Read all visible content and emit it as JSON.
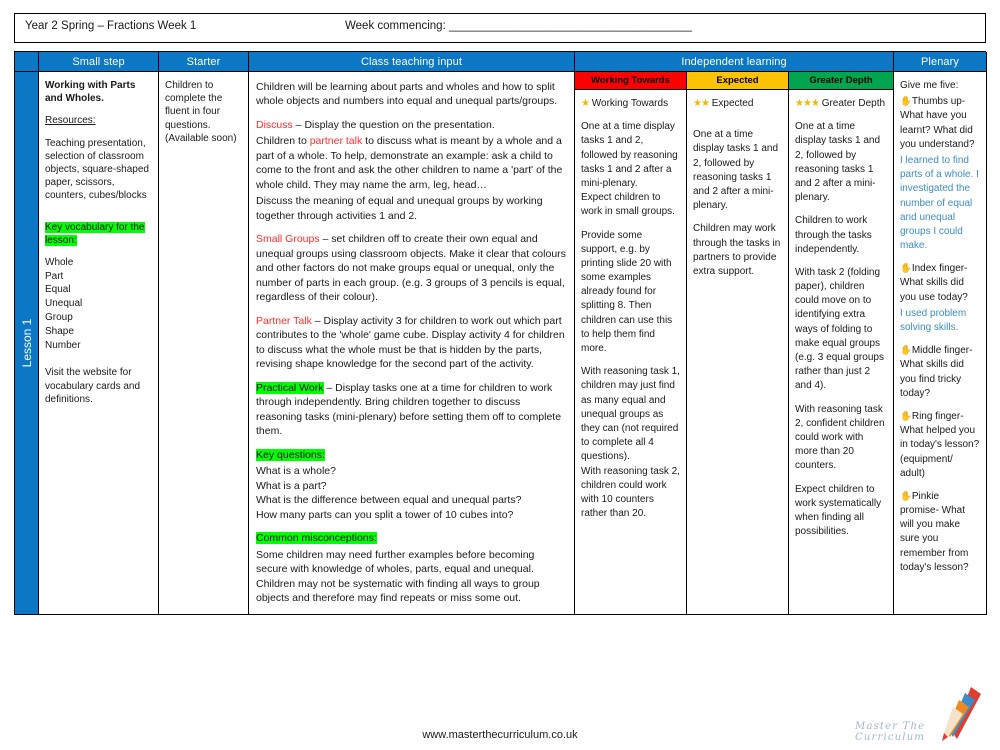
{
  "document": {
    "title_left": "Year 2 Spring – Fractions Week 1",
    "title_right": "Week commencing: ______________________________________",
    "footer_url": "www.masterthecurriculum.co.uk",
    "logo_wordmark": "Master The Curriculum"
  },
  "colors": {
    "header_blue": "#0C77C4",
    "working_towards_red": "#FE0000",
    "expected_amber": "#FDC201",
    "greater_depth_green": "#00A550",
    "highlight_green": "#00FF00",
    "accent_red_text": "#FF2E2E",
    "blue_text": "#3C8DC5"
  },
  "table": {
    "headers": {
      "lesson_spine": "",
      "small_step": "Small step",
      "starter": "Starter",
      "class_teaching_input": "Class teaching input",
      "independent_learning": "Independent learning",
      "plenary": "Plenary"
    },
    "subheaders": {
      "working_towards": "Working Towards",
      "expected": "Expected",
      "greater_depth": "Greater Depth"
    },
    "row": {
      "lesson_label": "Lesson 1",
      "small_step": {
        "heading": "Working with Parts and Wholes.",
        "resources_label": "Resources:",
        "resources_text": "Teaching presentation, selection of classroom objects, square-shaped paper, scissors, counters, cubes/blocks",
        "key_vocab_label": "Key vocabulary for the lesson:",
        "vocabulary": [
          "Whole",
          "Part",
          "Equal",
          "Unequal",
          "Group",
          "Shape",
          "Number"
        ],
        "website_note": "Visit the website for vocabulary cards and definitions."
      },
      "starter": {
        "text": "Children to complete the fluent in four questions. (Available soon)"
      },
      "class_teaching_input": {
        "intro": "Children will be learning about parts and wholes and how to split whole objects and numbers into equal and unequal parts/groups.",
        "discuss_label": "Discuss",
        "discuss_line1_rest": " – Display the question on the presentation.",
        "discuss_line2_a": "Children to ",
        "discuss_line2_link": "partner talk",
        "discuss_line2_b": " to discuss what is meant by a whole and a part of a whole. To help, demonstrate an example: ask a child to come to the front and ask the other children to name a 'part' of the whole child. They may name the arm, leg, head…",
        "discuss_line3": "Discuss the meaning of equal and unequal groups by working together through activities 1 and 2.",
        "small_groups_label": "Small Groups",
        "small_groups_text": " – set children off to create their own equal and unequal groups using classroom objects. Make it clear that colours and other factors do not make groups equal or unequal, only the number of parts in each group. (e.g. 3 groups of 3 pencils is equal, regardless of their colour).",
        "partner_talk_label": "Partner Talk",
        "partner_talk_text": " – Display activity 3 for children to work out which part contributes to the 'whole' game cube. Display activity 4 for children to discuss what the whole must be that is hidden by the parts, revising shape knowledge for the second part of the activity.",
        "practical_work_label": "Practical Work",
        "practical_work_text": " – Display tasks one at a time for children to work through independently. Bring children together to discuss reasoning tasks (mini-plenary) before setting them off to complete them.",
        "key_questions_label": "Key questions:",
        "key_questions": [
          "What is a whole?",
          "What is a part?",
          "What is the difference between equal and unequal parts?",
          "How many parts can you split a tower of 10 cubes into?"
        ],
        "common_misconceptions_label": "Common misconceptions:",
        "common_misconceptions": [
          "Some children may need further examples before becoming secure with knowledge of wholes, parts, equal and unequal.",
          "Children may not be systematic with finding all ways to group objects and therefore may find repeats or miss some out."
        ]
      },
      "working_towards": {
        "stars": "★",
        "label": "Working Towards",
        "paragraphs": [
          "One at a time display tasks 1 and 2, followed by reasoning tasks 1 and 2 after a mini-plenary.\nExpect children to work in small groups.",
          "Provide some support, e.g. by printing slide 20 with some examples already found for splitting 8. Then children can use this to help them find more.",
          "With reasoning task 1, children may just find as many equal and unequal groups as they can (not required to complete all 4 questions).\nWith reasoning task 2, children could work with 10 counters rather than 20."
        ]
      },
      "expected": {
        "stars": "★★",
        "label": "Expected",
        "paragraphs": [
          "One at a time display tasks 1 and 2, followed by reasoning tasks 1 and 2 after a mini-plenary.",
          "Children may work through the tasks in partners to provide extra support."
        ]
      },
      "greater_depth": {
        "stars": "★★★",
        "label": "Greater Depth",
        "paragraphs": [
          "One at a time display tasks 1 and 2, followed by reasoning tasks 1 and 2 after a mini-plenary.",
          "Children to work through the tasks independently.",
          "With task 2 (folding paper), children could move on to identifying extra ways of folding to make equal groups (e.g. 3 equal groups rather than just 2 and 4).",
          "With reasoning task 2, confident children could work with more than 20 counters.",
          "Expect children to work systematically when finding all possibilities."
        ]
      },
      "plenary": {
        "heading": "Give me five:",
        "items": [
          {
            "icon": "hand-icon",
            "question": "Thumbs up- What have you learnt? What did you understand?",
            "answer": "I learned to find parts of a whole. I investigated the number of equal and unequal groups I could make."
          },
          {
            "icon": "hand-icon",
            "question": "Index finger- What skills did you use today?",
            "answer": "I used problem solving skills."
          },
          {
            "icon": "hand-icon",
            "question": "Middle finger- What skills did you find tricky today?",
            "answer": ""
          },
          {
            "icon": "hand-icon",
            "question": "Ring finger- What helped you in today's lesson? (equipment/ adult)",
            "answer": ""
          },
          {
            "icon": "hand-icon",
            "question": "Pinkie promise- What will you make sure you remember from today's lesson?",
            "answer": ""
          }
        ]
      }
    }
  }
}
